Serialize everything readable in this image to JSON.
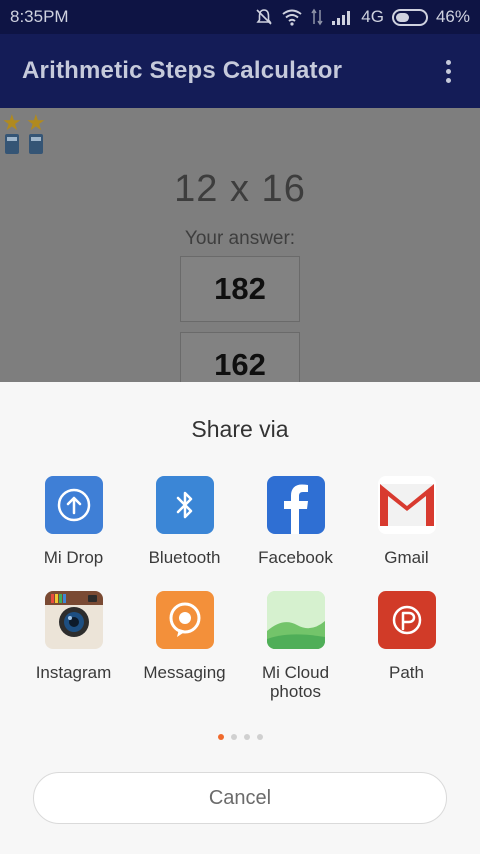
{
  "status_bar": {
    "time": "8:35PM",
    "network": "4G",
    "battery": "46%",
    "battery_level": 0.46,
    "icons": [
      "mute-icon",
      "wifi-icon",
      "data-transfer-icon",
      "signal-icon",
      "battery-icon"
    ]
  },
  "app_bar": {
    "title": "Arithmetic Steps Calculator",
    "overflow_icon": "more-vert-icon"
  },
  "quiz": {
    "problem": "12 x 16",
    "answer_label": "Your answer:",
    "answers": [
      "182",
      "162"
    ],
    "badges": [
      "star-calculator-icon",
      "star-calculator-icon"
    ]
  },
  "share_sheet": {
    "title": "Share via",
    "apps": [
      {
        "label": "Mi Drop",
        "icon": "mi-drop-icon"
      },
      {
        "label": "Bluetooth",
        "icon": "bluetooth-icon"
      },
      {
        "label": "Facebook",
        "icon": "facebook-icon"
      },
      {
        "label": "Gmail",
        "icon": "gmail-icon"
      },
      {
        "label": "Instagram",
        "icon": "instagram-icon"
      },
      {
        "label": "Messaging",
        "icon": "messaging-icon"
      },
      {
        "label": "Mi Cloud photos",
        "icon": "mi-cloud-photos-icon"
      },
      {
        "label": "Path",
        "icon": "path-icon"
      }
    ],
    "page_count": 4,
    "active_page": 1,
    "cancel_label": "Cancel"
  },
  "colors": {
    "status_bar": "#0e1444",
    "app_bar": "#141c57",
    "overlay": "#7e7e7e",
    "sheet": "#f7f7f7",
    "page_indicator_active": "#f06a2c"
  }
}
